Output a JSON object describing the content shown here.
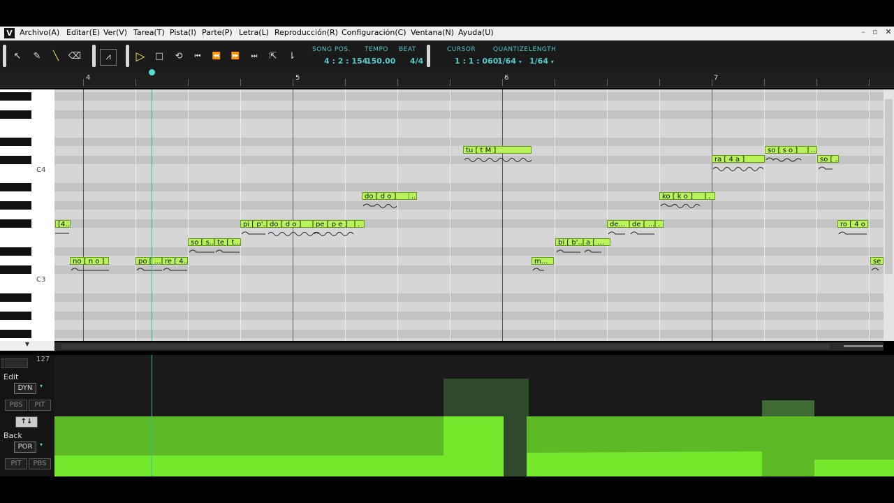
{
  "menubar": {
    "app_icon": "V",
    "items": [
      "Archivo(A)",
      "Editar(E)",
      "Ver(V)",
      "Tarea(T)",
      "Pista(I)",
      "Parte(P)",
      "Letra(L)",
      "Reproducción(R)",
      "Configuración(C)",
      "Ventana(N)",
      "Ayuda(U)"
    ],
    "window_controls": [
      "minimize-icon",
      "restore-icon",
      "close-icon"
    ]
  },
  "toolbar": {
    "tools": [
      "arrow-tool-icon",
      "pencil-tool-icon",
      "line-tool-icon",
      "eraser-tool-icon",
      "vibrato-tool-icon"
    ],
    "transport": [
      "play-icon",
      "stop-icon",
      "loop-icon",
      "go-to-start-icon",
      "rewind-icon",
      "fast-forward-icon",
      "go-to-end-icon",
      "auto-scroll-icon",
      "punch-icon"
    ],
    "song_pos": {
      "label": "SONG POS.",
      "value": "4 : 2 : 154"
    },
    "tempo": {
      "label": "TEMPO",
      "value": "150.00"
    },
    "beat": {
      "label": "BEAT",
      "value": "4/4"
    },
    "cursor": {
      "label": "CURSOR",
      "value": "1 : 1 : 060"
    },
    "quantize": {
      "label": "QUANTIZE",
      "value": "1/64"
    },
    "length": {
      "label": "LENGTH",
      "value": "1/64"
    }
  },
  "ruler": {
    "bars": [
      "4",
      "5",
      "6",
      "7"
    ]
  },
  "keyboard": {
    "labels": [
      "C4",
      "C3"
    ]
  },
  "notes": [
    {
      "lyric": "[4..."
    },
    {
      "lyric": "no [ n o ]"
    },
    {
      "lyric": "po [ ..."
    },
    {
      "lyric": "re [ 4..."
    },
    {
      "lyric": "so [ s..."
    },
    {
      "lyric": "te [ t..."
    },
    {
      "lyric": "pi [ p'..."
    },
    {
      "lyric": "do [ d o ]"
    },
    {
      "lyric": "pe [ p e ]"
    },
    {
      "lyric": "."
    },
    {
      "lyric": "do [ d o ]"
    },
    {
      "lyric": "..."
    },
    {
      "lyric": "tu [ t M ]"
    },
    {
      "lyric": "m..."
    },
    {
      "lyric": "bi [ b'..."
    },
    {
      "lyric": "a [ ..."
    },
    {
      "lyric": "de..."
    },
    {
      "lyric": "de [ ..."
    },
    {
      "lyric": "."
    },
    {
      "lyric": "ko [ k o ]"
    },
    {
      "lyric": "."
    },
    {
      "lyric": "ra [ 4 a ]"
    },
    {
      "lyric": "so [ s o ]"
    },
    {
      "lyric": "..."
    },
    {
      "lyric": "so [ ..."
    },
    {
      "lyric": "ro [ 4 o ]"
    },
    {
      "lyric": "se"
    }
  ],
  "control_panel": {
    "max_value": "127",
    "edit_label": "Edit",
    "edit_param": "DYN",
    "edit_buttons": [
      "PBS",
      "PIT"
    ],
    "swap_icon": "↑↓",
    "back_label": "Back",
    "back_param": "POR",
    "back_buttons": [
      "PIT",
      "PBS"
    ]
  },
  "colors": {
    "note_fill": "#b9f35a",
    "accent": "#4fc9c9",
    "control_green": "#74e82a",
    "control_dark_green": "#5dba26"
  }
}
